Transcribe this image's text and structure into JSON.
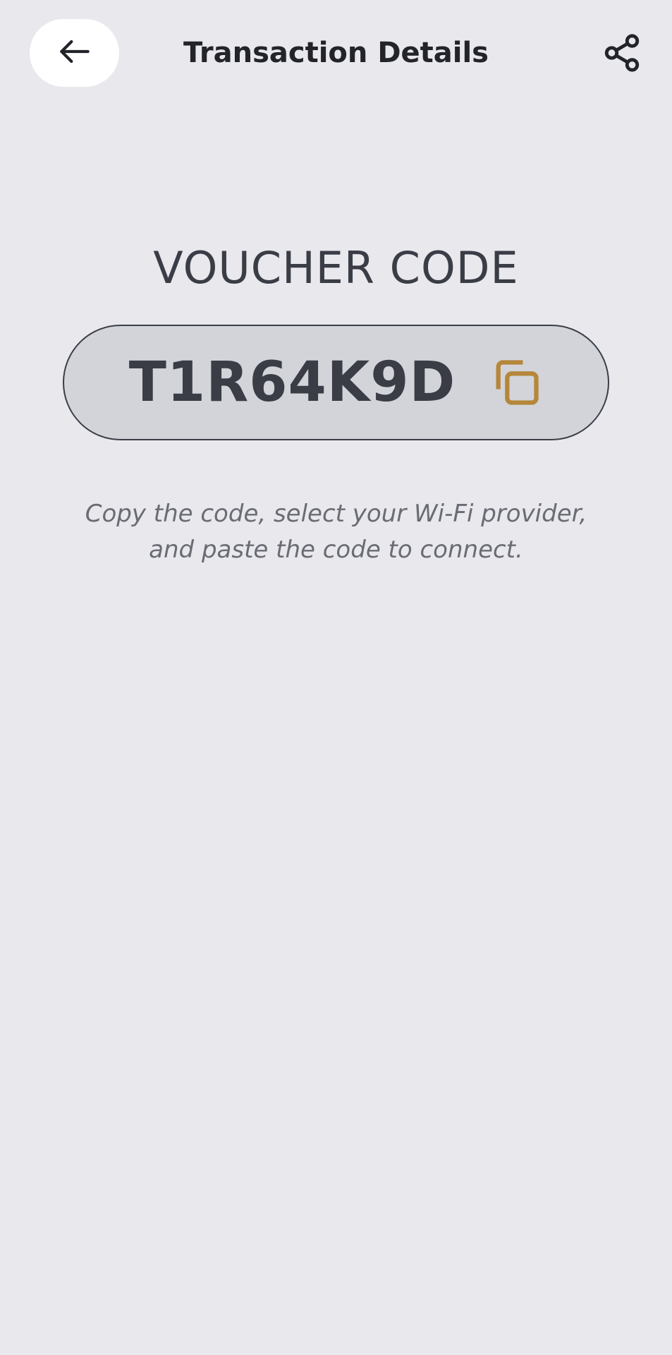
{
  "header": {
    "title": "Transaction Details",
    "back_icon": "arrow-left-icon",
    "share_icon": "share-icon"
  },
  "voucher": {
    "heading": "VOUCHER CODE",
    "code": "T1R64K9D",
    "copy_icon": "copy-icon",
    "instructions_line1": "Copy the code, select your Wi-Fi provider,",
    "instructions_line2": "and paste the code to connect."
  },
  "colors": {
    "background": "#e8e8ed",
    "pill_background": "#d3d4da",
    "text_dark": "#3a3d46",
    "accent": "#b5873a",
    "muted_text": "#6a6c74"
  }
}
